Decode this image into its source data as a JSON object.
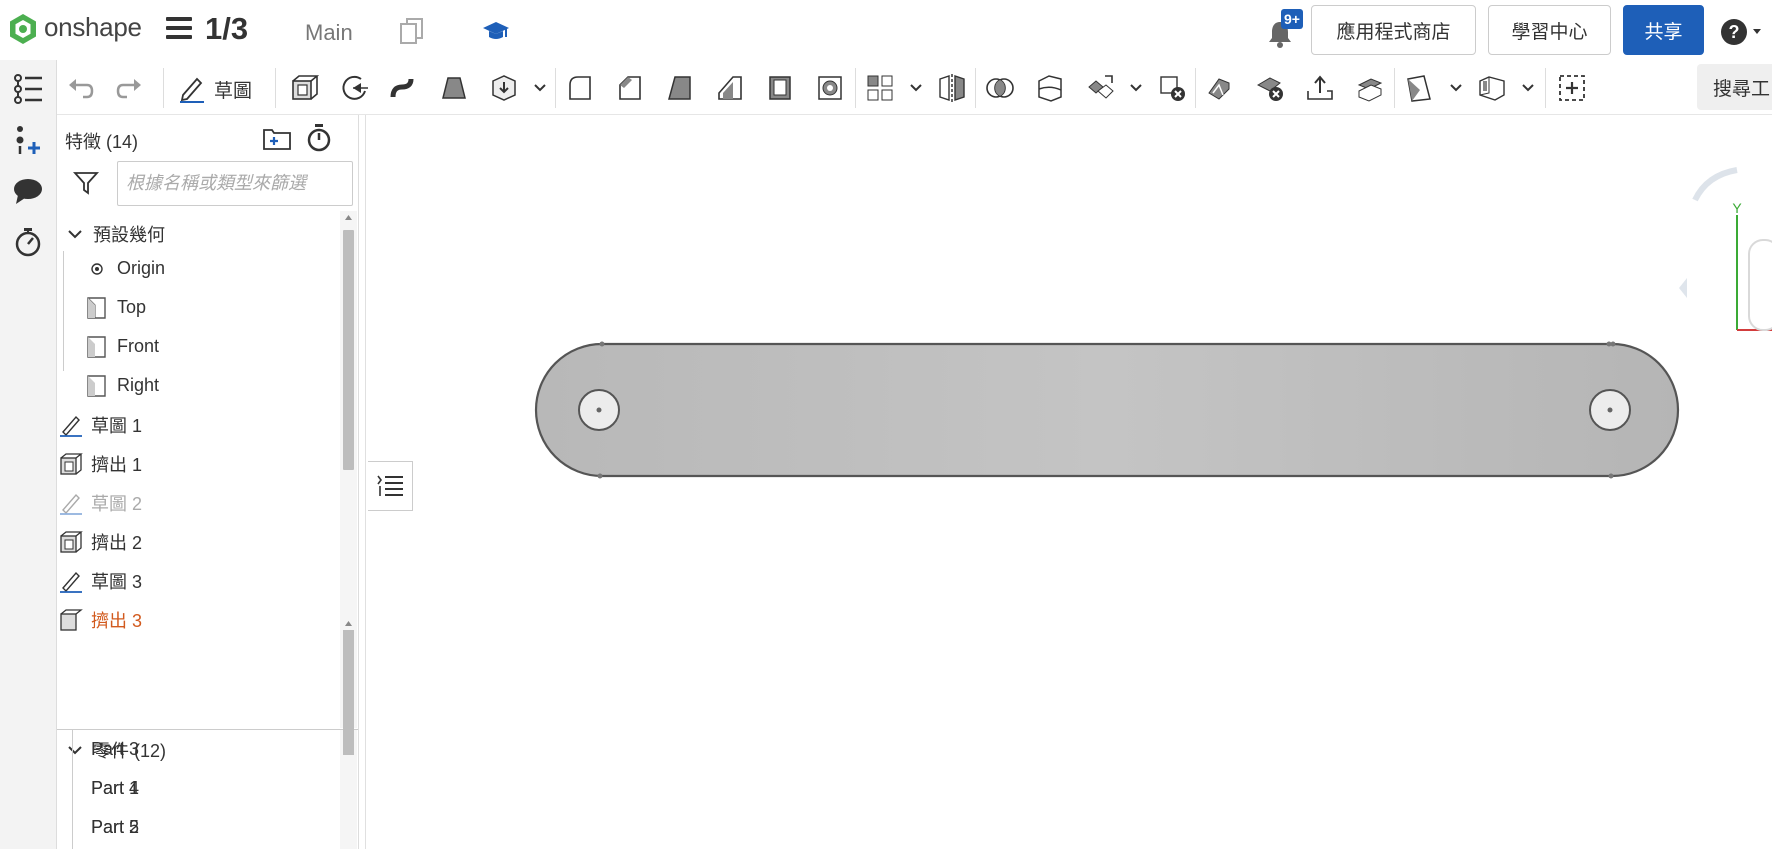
{
  "header": {
    "brand": "onshape",
    "doc_counter": "1/3",
    "workspace": "Main",
    "notification_badge": "9+",
    "app_store_label": "應用程式商店",
    "learning_center_label": "學習中心",
    "share_label": "共享",
    "accent_color": "#1e5fb8"
  },
  "toolbar": {
    "sketch_label": "草圖",
    "search_tools_label": "搜尋工"
  },
  "feature_panel": {
    "title": "特徵 (14)",
    "filter_placeholder": "根據名稱或類型來篩選",
    "default_geometry_label": "預設幾何",
    "planes": [
      {
        "label": "Origin"
      },
      {
        "label": "Top"
      },
      {
        "label": "Front"
      },
      {
        "label": "Right"
      }
    ],
    "features": [
      {
        "label": "草圖 1",
        "type": "sketch",
        "state": "normal"
      },
      {
        "label": "擠出 1",
        "type": "extrude",
        "state": "normal"
      },
      {
        "label": "草圖 2",
        "type": "sketch",
        "state": "suppressed"
      },
      {
        "label": "擠出 2",
        "type": "extrude",
        "state": "normal"
      },
      {
        "label": "草圖 3",
        "type": "sketch",
        "state": "normal"
      },
      {
        "label": "擠出 3",
        "type": "extrude",
        "state": "error"
      }
    ]
  },
  "parts_panel": {
    "title": "零件 (12)",
    "items": [
      {
        "label": "Part 1"
      },
      {
        "label": "Part 2"
      },
      {
        "label": "Part 3"
      },
      {
        "label": "Part 4"
      },
      {
        "label": "Part 5"
      }
    ]
  },
  "view_cube": {
    "y_axis_label": "Y"
  }
}
